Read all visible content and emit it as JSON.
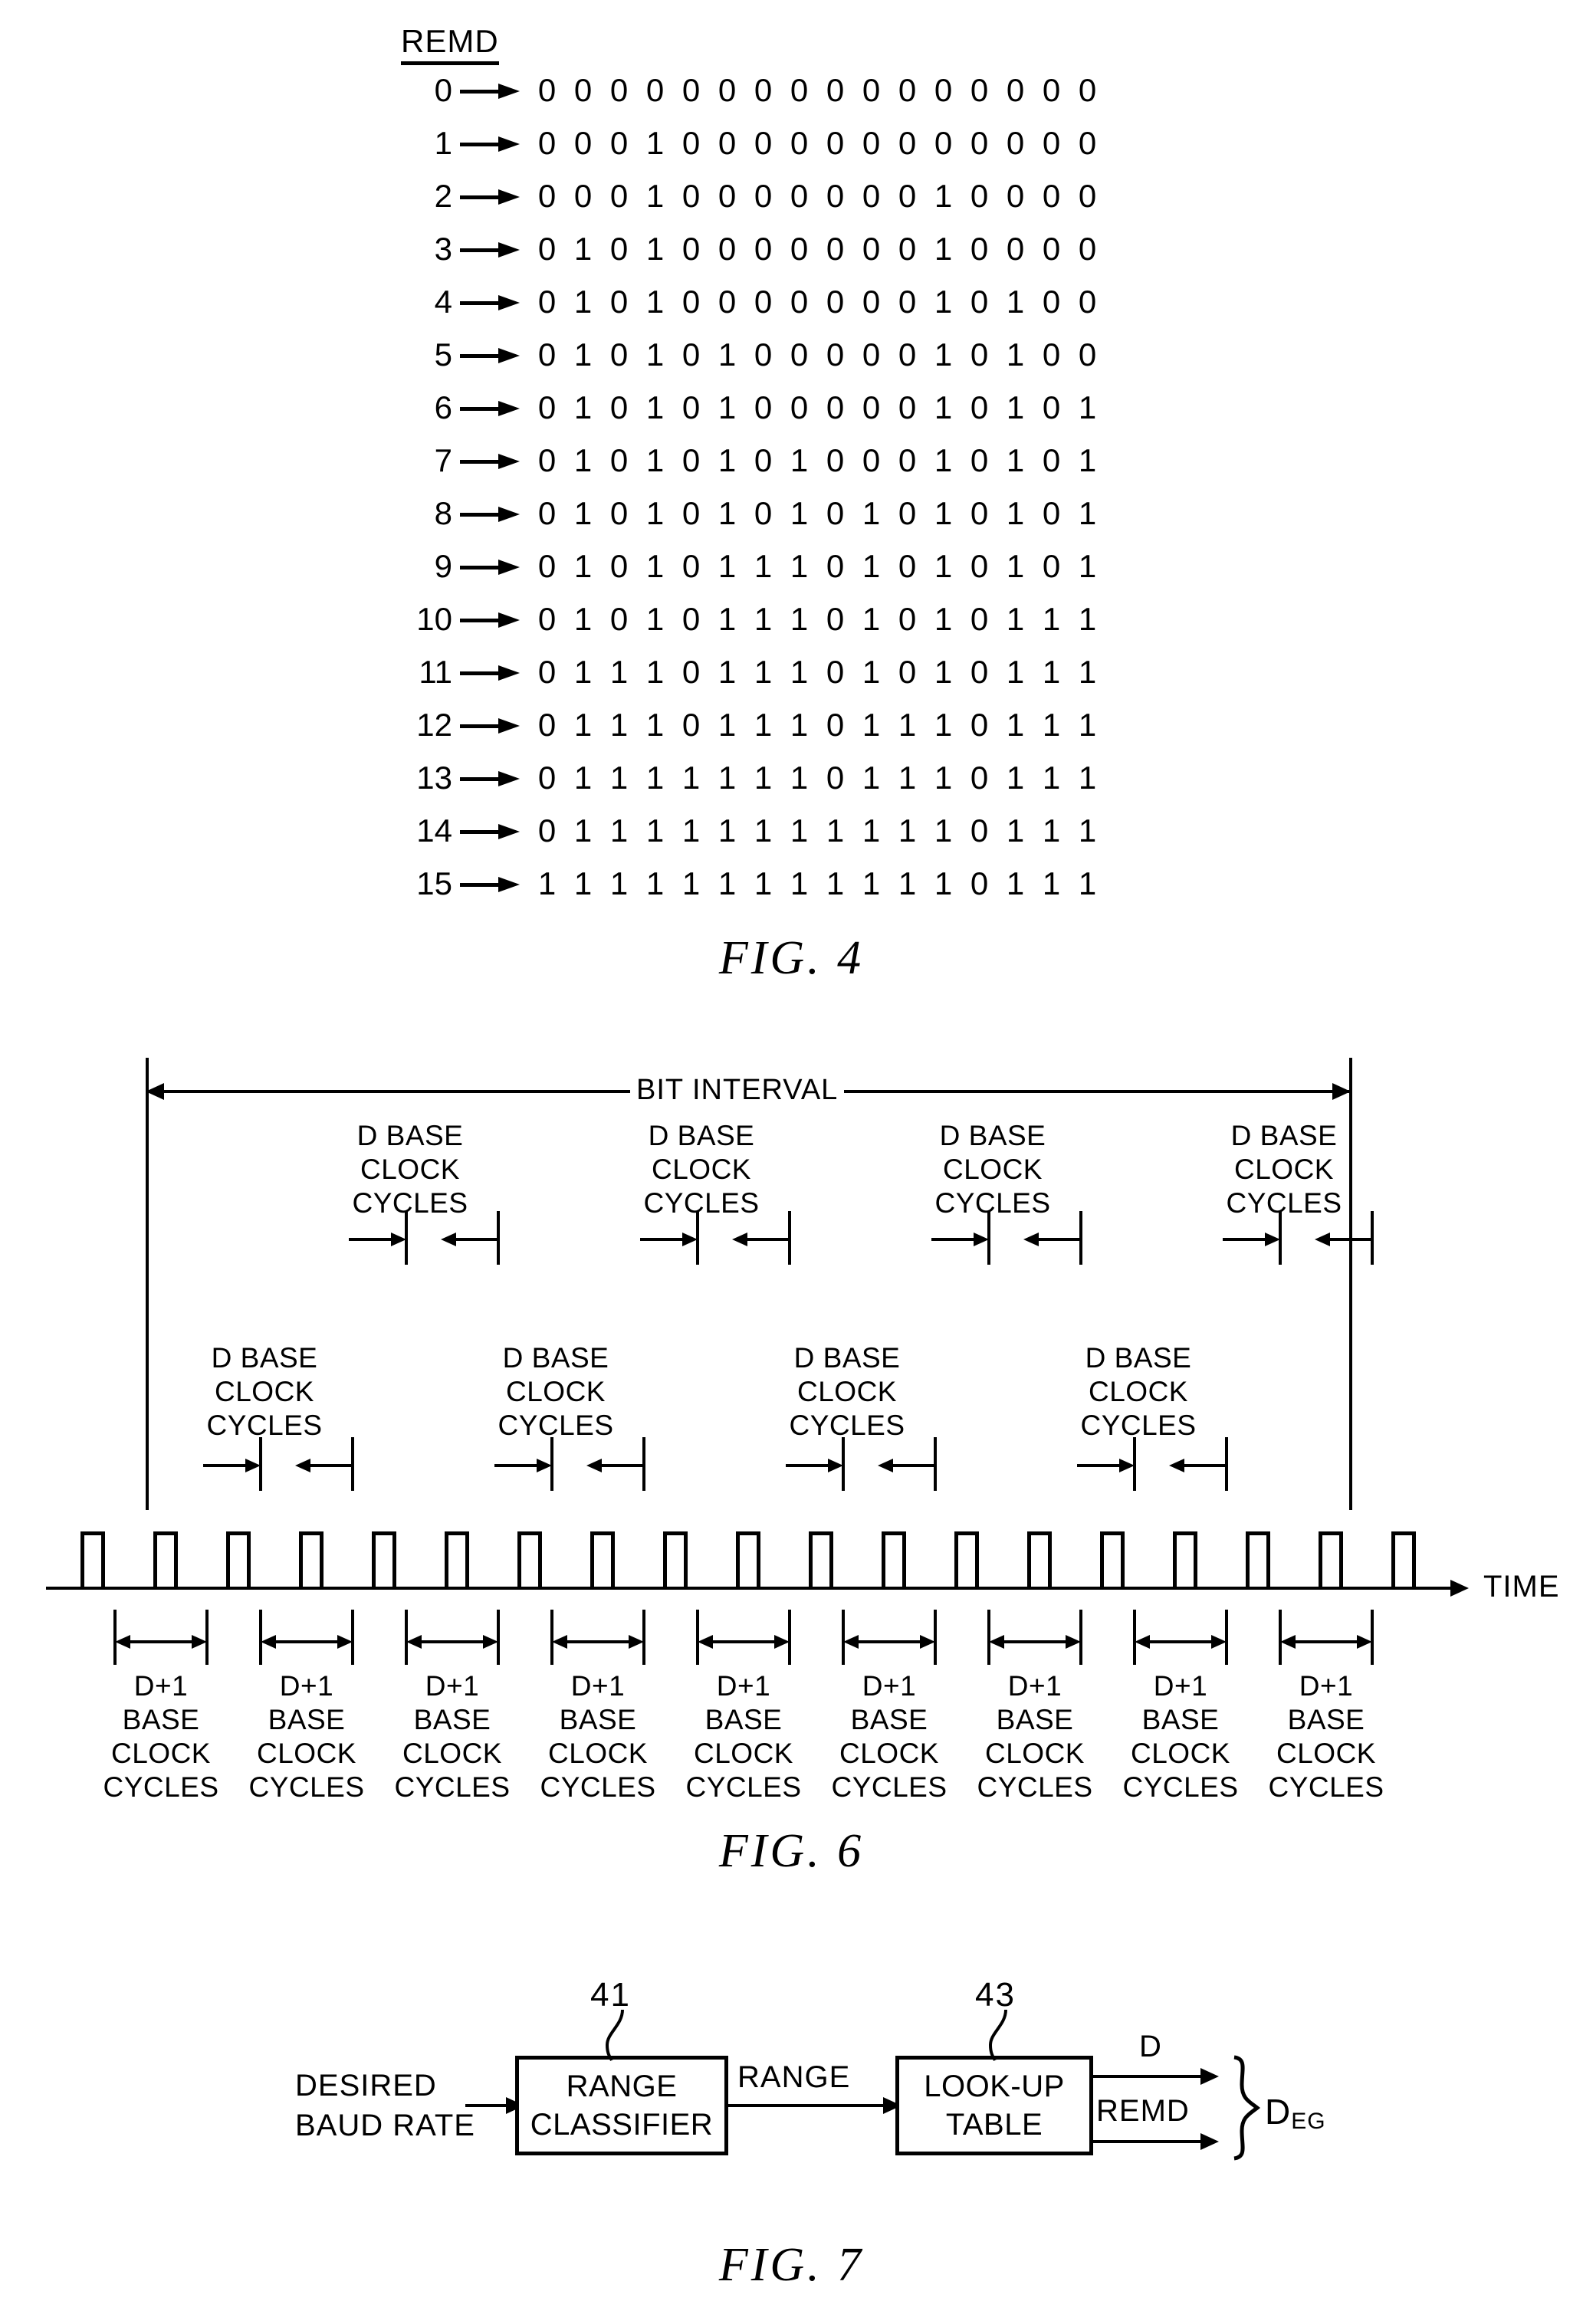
{
  "figures": [
    {
      "id": "fig4",
      "caption": "FIG.   4",
      "column_header": "REMD",
      "rows": [
        {
          "index": "0",
          "bits": [
            "0",
            "0",
            "0",
            "0",
            "0",
            "0",
            "0",
            "0",
            "0",
            "0",
            "0",
            "0",
            "0",
            "0",
            "0",
            "0"
          ]
        },
        {
          "index": "1",
          "bits": [
            "0",
            "0",
            "0",
            "1",
            "0",
            "0",
            "0",
            "0",
            "0",
            "0",
            "0",
            "0",
            "0",
            "0",
            "0",
            "0"
          ]
        },
        {
          "index": "2",
          "bits": [
            "0",
            "0",
            "0",
            "1",
            "0",
            "0",
            "0",
            "0",
            "0",
            "0",
            "0",
            "1",
            "0",
            "0",
            "0",
            "0"
          ]
        },
        {
          "index": "3",
          "bits": [
            "0",
            "1",
            "0",
            "1",
            "0",
            "0",
            "0",
            "0",
            "0",
            "0",
            "0",
            "1",
            "0",
            "0",
            "0",
            "0"
          ]
        },
        {
          "index": "4",
          "bits": [
            "0",
            "1",
            "0",
            "1",
            "0",
            "0",
            "0",
            "0",
            "0",
            "0",
            "0",
            "1",
            "0",
            "1",
            "0",
            "0"
          ]
        },
        {
          "index": "5",
          "bits": [
            "0",
            "1",
            "0",
            "1",
            "0",
            "1",
            "0",
            "0",
            "0",
            "0",
            "0",
            "1",
            "0",
            "1",
            "0",
            "0"
          ]
        },
        {
          "index": "6",
          "bits": [
            "0",
            "1",
            "0",
            "1",
            "0",
            "1",
            "0",
            "0",
            "0",
            "0",
            "0",
            "1",
            "0",
            "1",
            "0",
            "1"
          ]
        },
        {
          "index": "7",
          "bits": [
            "0",
            "1",
            "0",
            "1",
            "0",
            "1",
            "0",
            "1",
            "0",
            "0",
            "0",
            "1",
            "0",
            "1",
            "0",
            "1"
          ]
        },
        {
          "index": "8",
          "bits": [
            "0",
            "1",
            "0",
            "1",
            "0",
            "1",
            "0",
            "1",
            "0",
            "1",
            "0",
            "1",
            "0",
            "1",
            "0",
            "1"
          ]
        },
        {
          "index": "9",
          "bits": [
            "0",
            "1",
            "0",
            "1",
            "0",
            "1",
            "1",
            "1",
            "0",
            "1",
            "0",
            "1",
            "0",
            "1",
            "0",
            "1"
          ]
        },
        {
          "index": "10",
          "bits": [
            "0",
            "1",
            "0",
            "1",
            "0",
            "1",
            "1",
            "1",
            "0",
            "1",
            "0",
            "1",
            "0",
            "1",
            "1",
            "1"
          ]
        },
        {
          "index": "11",
          "bits": [
            "0",
            "1",
            "1",
            "1",
            "0",
            "1",
            "1",
            "1",
            "0",
            "1",
            "0",
            "1",
            "0",
            "1",
            "1",
            "1"
          ]
        },
        {
          "index": "12",
          "bits": [
            "0",
            "1",
            "1",
            "1",
            "0",
            "1",
            "1",
            "1",
            "0",
            "1",
            "1",
            "1",
            "0",
            "1",
            "1",
            "1"
          ]
        },
        {
          "index": "13",
          "bits": [
            "0",
            "1",
            "1",
            "1",
            "1",
            "1",
            "1",
            "1",
            "0",
            "1",
            "1",
            "1",
            "0",
            "1",
            "1",
            "1"
          ]
        },
        {
          "index": "14",
          "bits": [
            "0",
            "1",
            "1",
            "1",
            "1",
            "1",
            "1",
            "1",
            "1",
            "1",
            "1",
            "1",
            "0",
            "1",
            "1",
            "1"
          ]
        },
        {
          "index": "15",
          "bits": [
            "1",
            "1",
            "1",
            "1",
            "1",
            "1",
            "1",
            "1",
            "1",
            "1",
            "1",
            "1",
            "0",
            "1",
            "1",
            "1"
          ]
        }
      ]
    },
    {
      "id": "fig6",
      "caption": "FIG.   6",
      "span_label": "BIT INTERVAL",
      "time_axis_label": "TIME",
      "upper_d_labels": [
        "D  BASE\nCLOCK\nCYCLES",
        "D  BASE\nCLOCK\nCYCLES",
        "D  BASE\nCLOCK\nCYCLES",
        "D  BASE\nCLOCK\nCYCLES"
      ],
      "lower_d_labels": [
        "D  BASE\nCLOCK\nCYCLES",
        "D  BASE\nCLOCK\nCYCLES",
        "D  BASE\nCLOCK\nCYCLES",
        "D  BASE\nCLOCK\nCYCLES"
      ],
      "d_label_line1": "D  BASE",
      "d_label_line2": "CLOCK",
      "d_label_line3": "CYCLES",
      "d1_label_line1": "D+1",
      "d1_label_line2": "BASE",
      "d1_label_line3": "CLOCK",
      "d1_label_line4": "CYCLES",
      "d1_labels": [
        "D+1 BASE CLOCK CYCLES",
        "D+1 BASE CLOCK CYCLES",
        "D+1 BASE CLOCK CYCLES",
        "D+1 BASE CLOCK CYCLES",
        "D+1 BASE CLOCK CYCLES",
        "D+1 BASE CLOCK CYCLES",
        "D+1 BASE CLOCK CYCLES",
        "D+1 BASE CLOCK CYCLES",
        "D+1 BASE CLOCK CYCLES"
      ],
      "pulse_count": 19
    },
    {
      "id": "fig7",
      "caption": "FIG.   7",
      "input_label_line1": "DESIRED",
      "input_label_line2": "BAUD  RATE",
      "blocks": [
        {
          "ref": "41",
          "line1": "RANGE",
          "line2": "CLASSIFIER"
        },
        {
          "ref": "43",
          "line1": "LOOK-UP",
          "line2": "TABLE"
        }
      ],
      "interconnect_label": "RANGE",
      "output_labels": {
        "top": "D",
        "bottom": "REMD"
      },
      "bundle_label": "D",
      "bundle_label_sub": "EG"
    }
  ]
}
